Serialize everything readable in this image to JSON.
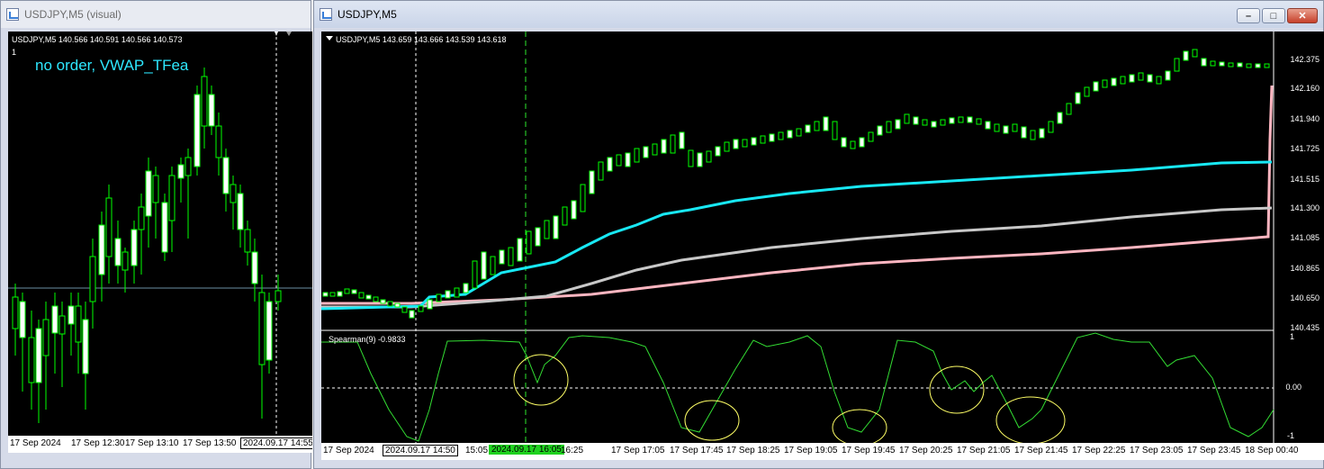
{
  "left_window": {
    "title": "USDJPY,M5 (visual)",
    "info_line": "USDJPY,M5  140.566 140.591 140.566 140.573",
    "info_line2": "1",
    "order_label": "no order, VWAP_TFea",
    "time_labels": [
      "17 Sep 2024",
      "17 Sep 12:30",
      "17 Sep 13:10",
      "17 Sep 13:50"
    ],
    "highlight_time": "2024.09.17 14:55"
  },
  "right_window": {
    "title": "USDJPY,M5",
    "controls": {
      "minimize": "minimize-button",
      "restore": "restore-button",
      "close": "close-button"
    },
    "info_line": "USDJPY,M5  143.659 143.666 143.539 143.618",
    "price_labels": [
      "142.375",
      "142.160",
      "141.940",
      "141.725",
      "141.515",
      "141.300",
      "141.085",
      "140.865",
      "140.650",
      "140.435"
    ],
    "indicator_label": "Spearman(9) -0.9833",
    "indicator_labels": [
      "1",
      "0.00",
      "-1"
    ],
    "time_labels": [
      "17 Sep 2024",
      "15:05",
      "16:25",
      "17 Sep 17:05",
      "17 Sep 17:45",
      "17 Sep 18:25",
      "17 Sep 19:05",
      "17 Sep 19:45",
      "17 Sep 20:25",
      "17 Sep 21:05",
      "17 Sep 21:45",
      "17 Sep 22:25",
      "17 Sep 23:05",
      "17 Sep 23:45",
      "18 Sep 00:40"
    ],
    "highlight_time_white": "2024.09.17 14:50",
    "highlight_time_green": "2024.09.17 16:05"
  },
  "colors": {
    "up_candle": "#ffffff",
    "candle_outline": "#00ff00",
    "vwap_cyan": "#18e8f4",
    "vwap_gray": "#c8c8c8",
    "vwap_pink": "#ffb6c1",
    "indicator": "#33dd33",
    "circle": "#ffff66"
  }
}
